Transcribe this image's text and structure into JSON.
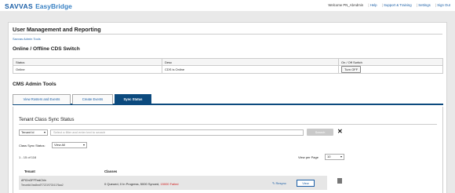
{
  "header": {
    "brand": "SAVVAS",
    "product": "EasyBridge",
    "welcome": "Welcome PN_AbAdmin",
    "links": [
      "Help",
      "Support & Training",
      "Settings",
      "Sign Out"
    ]
  },
  "page": {
    "title": "User Management and Reporting",
    "breadcrumb": "Savvas Admin Tools"
  },
  "cds_switch": {
    "title": "Online / Offline CDS Switch",
    "columns": [
      "Status",
      "Desc",
      "On / Off Switch"
    ],
    "row": {
      "status": "Online",
      "desc": "CDS is Online",
      "button": "Turn OFF"
    }
  },
  "cms_tools": {
    "title": "CMS Admin Tools",
    "tabs": [
      "View Rosters and Events",
      "Create Events",
      "Sync Status"
    ],
    "active_tab": "Sync Status"
  },
  "tenant_sync": {
    "title": "Tenant Class Sync Status",
    "filter_select": "Tenant Id",
    "search_placeholder": "Select a filter and enter text to search",
    "search_button": "Search",
    "close_symbol": "✕",
    "class_sync_label": "Class Sync Status:",
    "class_sync_value": "View All",
    "view_per_page_label": "View per Page",
    "view_per_page_value": "10",
    "count_text": "1 - 15 of 116",
    "columns": [
      "Tenant",
      "Classes"
    ],
    "rows": [
      {
        "tenant_name": "APIOnOFFTestChin",
        "tenant_id": "Tenantid:0ea8ea97722197024176aa2",
        "classes_text": "0 Queued, 0 In Progress, 5000 Synced, ",
        "classes_failed": "15000 Failed",
        "resync": "Resync",
        "view": "View"
      }
    ]
  },
  "colors": {
    "brand_blue": "#1a5ea6",
    "active_tab": "#0c4a7e",
    "failed_red": "#d01c1c"
  }
}
